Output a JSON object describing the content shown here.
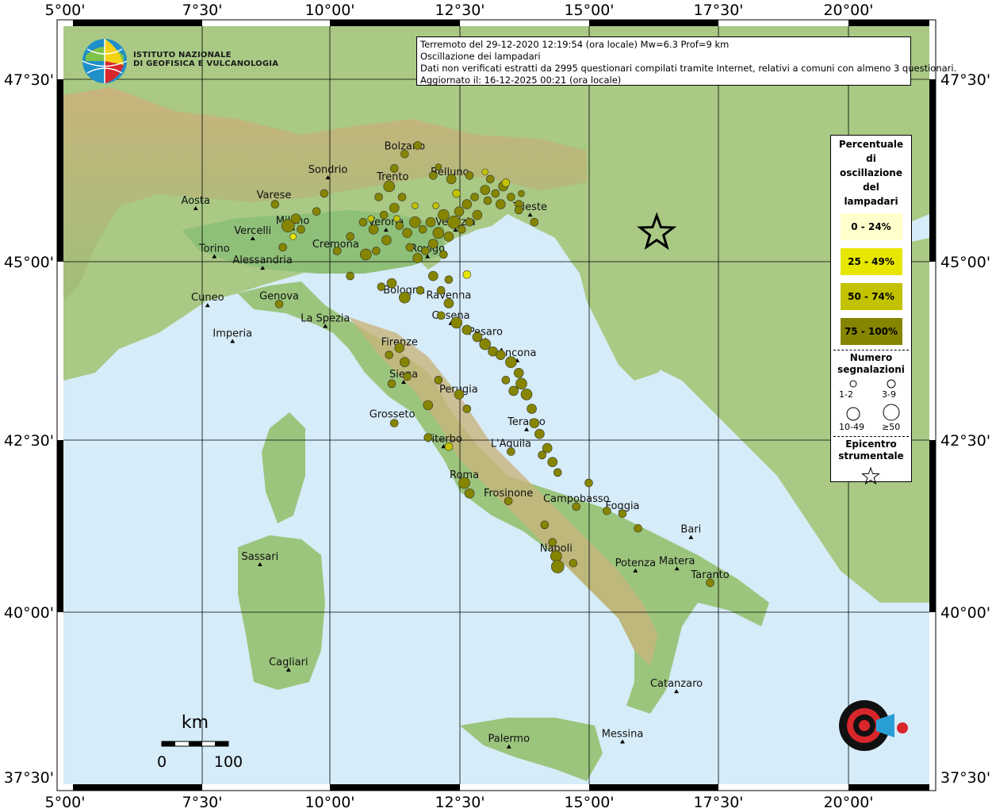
{
  "header": {
    "line1": "Terremoto del 29-12-2020 12:19:54 (ora locale) Mw=6.3 Prof=9 km",
    "line2": "Oscillazione dei lampadari",
    "line3": "Dati non verificati estratti da 2995 questionari compilati tramite Internet, relativi a comuni con almeno 3 questionari.",
    "line4": "Aggiornato il: 16-12-2025 00:21 (ora locale)"
  },
  "logo": {
    "line1": "ISTITUTO NAZIONALE",
    "line2": "DI GEOFISICA E VULCANOLOGIA"
  },
  "axes": {
    "top_labels": [
      "5°00'",
      "7°30'",
      "10°00'",
      "12°30'",
      "15°00'",
      "17°30'",
      "20°00'"
    ],
    "left_labels": [
      "47°30'",
      "45°00'",
      "42°30'",
      "40°00'",
      "37°30'"
    ],
    "right_labels": [
      "47°30'",
      "45°00'",
      "42°30'",
      "40°00'",
      "37°30'"
    ]
  },
  "legend": {
    "title_lines": [
      "Percentuale",
      "di",
      "oscillazione",
      "del",
      "lampadari"
    ],
    "classes": [
      {
        "label": "0 - 24%",
        "color": "#ffffcc"
      },
      {
        "label": "25 - 49%",
        "color": "#e6e600"
      },
      {
        "label": "50 - 74%",
        "color": "#c2c200"
      },
      {
        "label": "75 - 100%",
        "color": "#858500"
      }
    ],
    "count_title_lines": [
      "Numero",
      "segnalazioni"
    ],
    "count_sizes": [
      "1-2",
      "3-9",
      "10-49",
      "≥50"
    ],
    "epicenter_title_lines": [
      "Epicentro",
      "strumentale"
    ]
  },
  "scale": {
    "unit": "km",
    "start": "0",
    "end": "100"
  },
  "cities": [
    {
      "name": "Bolzano",
      "lon": 11.35,
      "lat": 46.5
    },
    {
      "name": "Trento",
      "lon": 11.12,
      "lat": 46.07
    },
    {
      "name": "Sondrio",
      "lon": 9.87,
      "lat": 46.17
    },
    {
      "name": "Belluno",
      "lon": 12.22,
      "lat": 46.14
    },
    {
      "name": "Varese",
      "lon": 8.83,
      "lat": 45.82
    },
    {
      "name": "Aosta",
      "lon": 7.32,
      "lat": 45.74
    },
    {
      "name": "Milano",
      "lon": 9.19,
      "lat": 45.46
    },
    {
      "name": "Verona",
      "lon": 10.99,
      "lat": 45.44
    },
    {
      "name": "Venezia",
      "lon": 12.33,
      "lat": 45.44
    },
    {
      "name": "Trieste",
      "lon": 13.77,
      "lat": 45.65
    },
    {
      "name": "Vercelli",
      "lon": 8.42,
      "lat": 45.32
    },
    {
      "name": "Cremona",
      "lon": 10.02,
      "lat": 45.13
    },
    {
      "name": "Rovigo",
      "lon": 11.79,
      "lat": 45.07
    },
    {
      "name": "Torino",
      "lon": 7.68,
      "lat": 45.07
    },
    {
      "name": "Alessandria",
      "lon": 8.61,
      "lat": 44.91
    },
    {
      "name": "Bologna",
      "lon": 11.34,
      "lat": 44.49
    },
    {
      "name": "Ravenna",
      "lon": 12.2,
      "lat": 44.42
    },
    {
      "name": "Cuneo",
      "lon": 7.55,
      "lat": 44.39
    },
    {
      "name": "Genova",
      "lon": 8.93,
      "lat": 44.41
    },
    {
      "name": "Cesena",
      "lon": 12.24,
      "lat": 44.14
    },
    {
      "name": "La Spezia",
      "lon": 9.82,
      "lat": 44.1
    },
    {
      "name": "Pesaro",
      "lon": 12.91,
      "lat": 43.91
    },
    {
      "name": "Imperia",
      "lon": 8.03,
      "lat": 43.89
    },
    {
      "name": "Firenze",
      "lon": 11.25,
      "lat": 43.77
    },
    {
      "name": "Ancona",
      "lon": 13.52,
      "lat": 43.62
    },
    {
      "name": "Siena",
      "lon": 11.33,
      "lat": 43.32
    },
    {
      "name": "Perugia",
      "lon": 12.39,
      "lat": 43.11
    },
    {
      "name": "Grosseto",
      "lon": 11.11,
      "lat": 42.76
    },
    {
      "name": "Teramo",
      "lon": 13.7,
      "lat": 42.66
    },
    {
      "name": "Viterbo",
      "lon": 12.1,
      "lat": 42.42
    },
    {
      "name": "L'Aquila",
      "lon": 13.4,
      "lat": 42.35
    },
    {
      "name": "Roma",
      "lon": 12.5,
      "lat": 41.9
    },
    {
      "name": "Frosinone",
      "lon": 13.35,
      "lat": 41.64
    },
    {
      "name": "Campobasso",
      "lon": 14.66,
      "lat": 41.56
    },
    {
      "name": "Foggia",
      "lon": 15.55,
      "lat": 41.46
    },
    {
      "name": "Bari",
      "lon": 16.87,
      "lat": 41.12
    },
    {
      "name": "Napoli",
      "lon": 14.27,
      "lat": 40.85
    },
    {
      "name": "Sassari",
      "lon": 8.56,
      "lat": 40.73
    },
    {
      "name": "Potenza",
      "lon": 15.8,
      "lat": 40.64
    },
    {
      "name": "Matera",
      "lon": 16.6,
      "lat": 40.67
    },
    {
      "name": "Taranto",
      "lon": 17.24,
      "lat": 40.47
    },
    {
      "name": "Cagliari",
      "lon": 9.11,
      "lat": 39.22
    },
    {
      "name": "Catanzaro",
      "lon": 16.59,
      "lat": 38.91
    },
    {
      "name": "Palermo",
      "lon": 13.36,
      "lat": 38.12
    },
    {
      "name": "Messina",
      "lon": 15.55,
      "lat": 38.19
    }
  ],
  "epicenter": {
    "lon": 16.21,
    "lat": 45.4
  },
  "observations": [
    {
      "lon": 12.3,
      "lat": 45.55,
      "r": 8,
      "c": 3
    },
    {
      "lon": 12.4,
      "lat": 45.7,
      "r": 6,
      "c": 3
    },
    {
      "lon": 12.1,
      "lat": 45.65,
      "r": 7,
      "c": 3
    },
    {
      "lon": 12.55,
      "lat": 45.8,
      "r": 6,
      "c": 3
    },
    {
      "lon": 12.7,
      "lat": 45.9,
      "r": 5,
      "c": 3
    },
    {
      "lon": 12.9,
      "lat": 46.0,
      "r": 6,
      "c": 3
    },
    {
      "lon": 13.1,
      "lat": 45.95,
      "r": 5,
      "c": 3
    },
    {
      "lon": 13.25,
      "lat": 46.05,
      "r": 6,
      "c": 3
    },
    {
      "lon": 13.4,
      "lat": 45.9,
      "r": 5,
      "c": 3
    },
    {
      "lon": 13.55,
      "lat": 45.8,
      "r": 5,
      "c": 3
    },
    {
      "lon": 13.6,
      "lat": 45.95,
      "r": 4,
      "c": 3
    },
    {
      "lon": 13.2,
      "lat": 45.8,
      "r": 6,
      "c": 3
    },
    {
      "lon": 12.95,
      "lat": 45.85,
      "r": 5,
      "c": 3
    },
    {
      "lon": 12.75,
      "lat": 45.65,
      "r": 6,
      "c": 3
    },
    {
      "lon": 12.6,
      "lat": 45.55,
      "r": 5,
      "c": 3
    },
    {
      "lon": 12.45,
      "lat": 45.45,
      "r": 5,
      "c": 3
    },
    {
      "lon": 12.2,
      "lat": 45.35,
      "r": 6,
      "c": 3
    },
    {
      "lon": 12.0,
      "lat": 45.4,
      "r": 7,
      "c": 3
    },
    {
      "lon": 11.85,
      "lat": 45.55,
      "r": 6,
      "c": 3
    },
    {
      "lon": 11.7,
      "lat": 45.45,
      "r": 5,
      "c": 3
    },
    {
      "lon": 11.55,
      "lat": 45.55,
      "r": 7,
      "c": 3
    },
    {
      "lon": 11.4,
      "lat": 45.4,
      "r": 6,
      "c": 3
    },
    {
      "lon": 11.25,
      "lat": 45.5,
      "r": 5,
      "c": 3
    },
    {
      "lon": 11.9,
      "lat": 45.25,
      "r": 6,
      "c": 3
    },
    {
      "lon": 11.75,
      "lat": 45.15,
      "r": 5,
      "c": 3
    },
    {
      "lon": 12.1,
      "lat": 45.1,
      "r": 5,
      "c": 3
    },
    {
      "lon": 11.6,
      "lat": 45.05,
      "r": 6,
      "c": 3
    },
    {
      "lon": 11.45,
      "lat": 45.2,
      "r": 5,
      "c": 3
    },
    {
      "lon": 11.0,
      "lat": 45.3,
      "r": 6,
      "c": 3
    },
    {
      "lon": 10.8,
      "lat": 45.15,
      "r": 5,
      "c": 3
    },
    {
      "lon": 10.75,
      "lat": 45.45,
      "r": 6,
      "c": 3
    },
    {
      "lon": 10.95,
      "lat": 45.65,
      "r": 5,
      "c": 3
    },
    {
      "lon": 11.15,
      "lat": 45.75,
      "r": 6,
      "c": 3
    },
    {
      "lon": 11.3,
      "lat": 45.9,
      "r": 5,
      "c": 3
    },
    {
      "lon": 11.05,
      "lat": 46.05,
      "r": 7,
      "c": 3
    },
    {
      "lon": 10.85,
      "lat": 45.9,
      "r": 5,
      "c": 3
    },
    {
      "lon": 11.35,
      "lat": 46.5,
      "r": 5,
      "c": 3
    },
    {
      "lon": 11.6,
      "lat": 46.62,
      "r": 5,
      "c": 3
    },
    {
      "lon": 11.15,
      "lat": 46.3,
      "r": 5,
      "c": 3
    },
    {
      "lon": 11.9,
      "lat": 46.2,
      "r": 5,
      "c": 3
    },
    {
      "lon": 12.25,
      "lat": 46.15,
      "r": 6,
      "c": 3
    },
    {
      "lon": 12.6,
      "lat": 46.2,
      "r": 5,
      "c": 3
    },
    {
      "lon": 13.0,
      "lat": 46.15,
      "r": 5,
      "c": 3
    },
    {
      "lon": 12.0,
      "lat": 46.32,
      "r": 4,
      "c": 3
    },
    {
      "lon": 12.9,
      "lat": 46.25,
      "r": 4,
      "c": 2
    },
    {
      "lon": 13.3,
      "lat": 46.1,
      "r": 5,
      "c": 2
    },
    {
      "lon": 12.35,
      "lat": 45.95,
      "r": 5,
      "c": 2
    },
    {
      "lon": 11.95,
      "lat": 45.78,
      "r": 4,
      "c": 2
    },
    {
      "lon": 11.55,
      "lat": 45.78,
      "r": 4,
      "c": 2
    },
    {
      "lon": 11.2,
      "lat": 45.6,
      "r": 4,
      "c": 2
    },
    {
      "lon": 10.7,
      "lat": 45.6,
      "r": 4,
      "c": 2
    },
    {
      "lon": 12.55,
      "lat": 44.82,
      "r": 5,
      "c": 1
    },
    {
      "lon": 9.2,
      "lat": 45.35,
      "r": 4,
      "c": 1
    },
    {
      "lon": 13.55,
      "lat": 45.72,
      "r": 5,
      "c": 3
    },
    {
      "lon": 9.1,
      "lat": 45.5,
      "r": 8,
      "c": 3
    },
    {
      "lon": 9.25,
      "lat": 45.6,
      "r": 6,
      "c": 3
    },
    {
      "lon": 9.35,
      "lat": 45.45,
      "r": 5,
      "c": 3
    },
    {
      "lon": 9.0,
      "lat": 45.2,
      "r": 5,
      "c": 3
    },
    {
      "lon": 8.85,
      "lat": 45.8,
      "r": 5,
      "c": 3
    },
    {
      "lon": 9.65,
      "lat": 45.7,
      "r": 5,
      "c": 3
    },
    {
      "lon": 10.05,
      "lat": 45.15,
      "r": 5,
      "c": 3
    },
    {
      "lon": 10.3,
      "lat": 45.35,
      "r": 5,
      "c": 3
    },
    {
      "lon": 10.55,
      "lat": 45.55,
      "r": 5,
      "c": 3
    },
    {
      "lon": 10.6,
      "lat": 45.1,
      "r": 7,
      "c": 3
    },
    {
      "lon": 10.3,
      "lat": 44.8,
      "r": 5,
      "c": 3
    },
    {
      "lon": 10.9,
      "lat": 44.65,
      "r": 5,
      "c": 3
    },
    {
      "lon": 11.1,
      "lat": 44.7,
      "r": 6,
      "c": 3
    },
    {
      "lon": 11.35,
      "lat": 44.5,
      "r": 7,
      "c": 3
    },
    {
      "lon": 11.65,
      "lat": 44.6,
      "r": 5,
      "c": 3
    },
    {
      "lon": 11.9,
      "lat": 44.8,
      "r": 6,
      "c": 3
    },
    {
      "lon": 12.2,
      "lat": 44.75,
      "r": 5,
      "c": 3
    },
    {
      "lon": 12.05,
      "lat": 44.6,
      "r": 5,
      "c": 3
    },
    {
      "lon": 12.2,
      "lat": 44.42,
      "r": 6,
      "c": 3
    },
    {
      "lon": 12.05,
      "lat": 44.25,
      "r": 5,
      "c": 3
    },
    {
      "lon": 12.35,
      "lat": 44.15,
      "r": 7,
      "c": 3
    },
    {
      "lon": 12.55,
      "lat": 44.05,
      "r": 6,
      "c": 3
    },
    {
      "lon": 12.75,
      "lat": 43.95,
      "r": 6,
      "c": 3
    },
    {
      "lon": 12.9,
      "lat": 43.85,
      "r": 7,
      "c": 3
    },
    {
      "lon": 13.05,
      "lat": 43.75,
      "r": 6,
      "c": 3
    },
    {
      "lon": 13.2,
      "lat": 43.7,
      "r": 6,
      "c": 3
    },
    {
      "lon": 13.4,
      "lat": 43.6,
      "r": 7,
      "c": 3
    },
    {
      "lon": 13.55,
      "lat": 43.45,
      "r": 6,
      "c": 3
    },
    {
      "lon": 13.6,
      "lat": 43.3,
      "r": 7,
      "c": 3
    },
    {
      "lon": 13.7,
      "lat": 43.15,
      "r": 7,
      "c": 3
    },
    {
      "lon": 13.45,
      "lat": 43.2,
      "r": 6,
      "c": 3
    },
    {
      "lon": 13.3,
      "lat": 43.35,
      "r": 5,
      "c": 3
    },
    {
      "lon": 13.8,
      "lat": 42.95,
      "r": 6,
      "c": 3
    },
    {
      "lon": 13.85,
      "lat": 42.75,
      "r": 6,
      "c": 3
    },
    {
      "lon": 13.95,
      "lat": 42.6,
      "r": 6,
      "c": 3
    },
    {
      "lon": 14.1,
      "lat": 42.4,
      "r": 6,
      "c": 3
    },
    {
      "lon": 14.2,
      "lat": 42.2,
      "r": 6,
      "c": 3
    },
    {
      "lon": 14.0,
      "lat": 42.3,
      "r": 5,
      "c": 3
    },
    {
      "lon": 14.3,
      "lat": 42.05,
      "r": 5,
      "c": 3
    },
    {
      "lon": 13.4,
      "lat": 42.35,
      "r": 5,
      "c": 3
    },
    {
      "lon": 11.25,
      "lat": 43.8,
      "r": 6,
      "c": 3
    },
    {
      "lon": 11.35,
      "lat": 43.6,
      "r": 6,
      "c": 3
    },
    {
      "lon": 11.05,
      "lat": 43.7,
      "r": 5,
      "c": 3
    },
    {
      "lon": 11.4,
      "lat": 43.4,
      "r": 5,
      "c": 3
    },
    {
      "lon": 11.1,
      "lat": 43.3,
      "r": 5,
      "c": 3
    },
    {
      "lon": 12.0,
      "lat": 43.35,
      "r": 5,
      "c": 3
    },
    {
      "lon": 12.4,
      "lat": 43.15,
      "r": 6,
      "c": 3
    },
    {
      "lon": 11.8,
      "lat": 43.0,
      "r": 6,
      "c": 3
    },
    {
      "lon": 12.55,
      "lat": 42.95,
      "r": 5,
      "c": 3
    },
    {
      "lon": 11.15,
      "lat": 42.75,
      "r": 5,
      "c": 3
    },
    {
      "lon": 11.8,
      "lat": 42.55,
      "r": 5,
      "c": 3
    },
    {
      "lon": 12.2,
      "lat": 42.42,
      "r": 5,
      "c": 2
    },
    {
      "lon": 12.5,
      "lat": 41.9,
      "r": 7,
      "c": 3
    },
    {
      "lon": 12.6,
      "lat": 41.75,
      "r": 6,
      "c": 3
    },
    {
      "lon": 13.35,
      "lat": 41.64,
      "r": 5,
      "c": 3
    },
    {
      "lon": 14.66,
      "lat": 41.56,
      "r": 5,
      "c": 3
    },
    {
      "lon": 15.25,
      "lat": 41.5,
      "r": 5,
      "c": 3
    },
    {
      "lon": 15.55,
      "lat": 41.46,
      "r": 5,
      "c": 3
    },
    {
      "lon": 15.85,
      "lat": 41.25,
      "r": 5,
      "c": 3
    },
    {
      "lon": 14.9,
      "lat": 41.9,
      "r": 5,
      "c": 3
    },
    {
      "lon": 14.27,
      "lat": 40.85,
      "r": 7,
      "c": 3
    },
    {
      "lon": 14.3,
      "lat": 40.7,
      "r": 8,
      "c": 3
    },
    {
      "lon": 14.2,
      "lat": 41.05,
      "r": 5,
      "c": 3
    },
    {
      "lon": 14.6,
      "lat": 40.75,
      "r": 5,
      "c": 3
    },
    {
      "lon": 14.05,
      "lat": 41.3,
      "r": 5,
      "c": 3
    },
    {
      "lon": 17.24,
      "lat": 40.47,
      "r": 5,
      "c": 3
    },
    {
      "lon": 8.93,
      "lat": 44.41,
      "r": 5,
      "c": 3
    },
    {
      "lon": 9.8,
      "lat": 45.95,
      "r": 5,
      "c": 3
    },
    {
      "lon": 13.85,
      "lat": 45.55,
      "r": 5,
      "c": 3
    }
  ]
}
